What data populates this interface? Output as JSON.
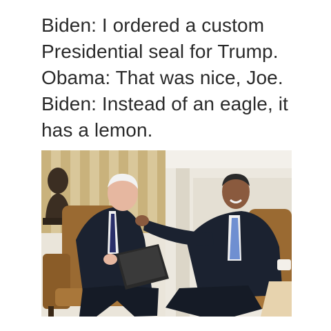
{
  "caption": {
    "lines": [
      "Biden: I ordered a custom",
      "Presidential seal for Trump.",
      "Obama: That was nice, Joe.",
      "Biden: Instead of an eagle, it",
      "has a lemon."
    ]
  },
  "photo": {
    "subject_left": "man in dark suit holding a black folder, seated in a leather armchair",
    "subject_right": "smiling man in dark suit with blue tie, reaching out to touch the other man's face",
    "background_bust": "bronze bust",
    "colors": {
      "wall": "#d9c79a",
      "curtain": "#c9a86a",
      "chair": "#9a6a32",
      "suit": "#1b2230",
      "tie_left": "#2a2f6a",
      "tie_right": "#6f8fd1",
      "skin": "#e2b29a",
      "skin_right": "#8a5a3e",
      "mantel": "#e8e3d8"
    }
  }
}
